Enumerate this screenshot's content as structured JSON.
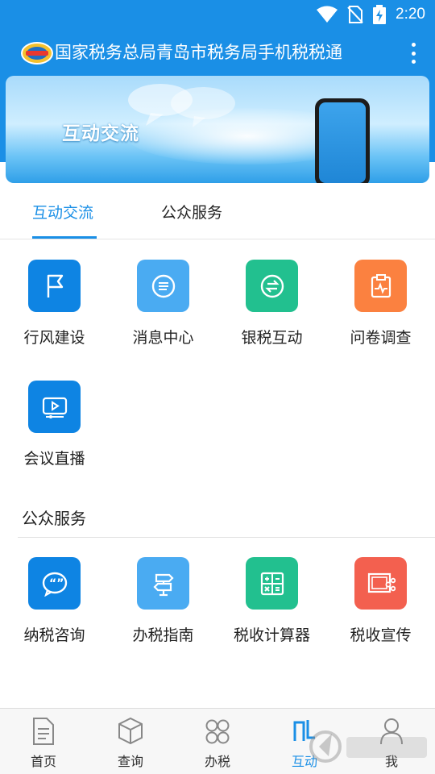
{
  "status_bar": {
    "time": "2:20",
    "icons": [
      "wifi-icon",
      "no-sim-icon",
      "battery-charging-icon"
    ]
  },
  "app_bar": {
    "title": "国家税务总局青岛市税务局手机税税通",
    "logo": "app-logo-icon",
    "menu_icon": "more-vert-icon"
  },
  "banner": {
    "title": "互动交流"
  },
  "tabs": [
    {
      "label": "互动交流",
      "active": true
    },
    {
      "label": "公众服务",
      "active": false
    }
  ],
  "interaction_items": [
    {
      "label": "行风建设",
      "icon": "flag-icon",
      "color": "#0e84e3"
    },
    {
      "label": "消息中心",
      "icon": "chat-bubble-icon",
      "color": "#4aabf2"
    },
    {
      "label": "银税互动",
      "icon": "exchange-icon",
      "color": "#22c08f"
    },
    {
      "label": "问卷调查",
      "icon": "clipboard-pulse-icon",
      "color": "#fb8140"
    },
    {
      "label": "会议直播",
      "icon": "video-play-icon",
      "color": "#0e84e3"
    }
  ],
  "public_section": {
    "heading": "公众服务"
  },
  "public_items": [
    {
      "label": "纳税咨询",
      "icon": "quote-bubble-icon",
      "color": "#0e84e3"
    },
    {
      "label": "办税指南",
      "icon": "signpost-icon",
      "color": "#4aabf2"
    },
    {
      "label": "税收计算器",
      "icon": "calculator-icon",
      "color": "#22c08f"
    },
    {
      "label": "税收宣传",
      "icon": "share-screen-icon",
      "color": "#f3604f"
    }
  ],
  "bottom_nav": [
    {
      "label": "首页",
      "icon": "document-icon",
      "active": false
    },
    {
      "label": "查询",
      "icon": "cube-icon",
      "active": false
    },
    {
      "label": "办税",
      "icon": "grid-circles-icon",
      "active": false
    },
    {
      "label": "互动",
      "icon": "interact-icon",
      "active": true
    },
    {
      "label": "我",
      "icon": "person-icon",
      "active": false
    }
  ],
  "colors": {
    "primary": "#1a8fe6",
    "divider": "#e5e5e5"
  }
}
